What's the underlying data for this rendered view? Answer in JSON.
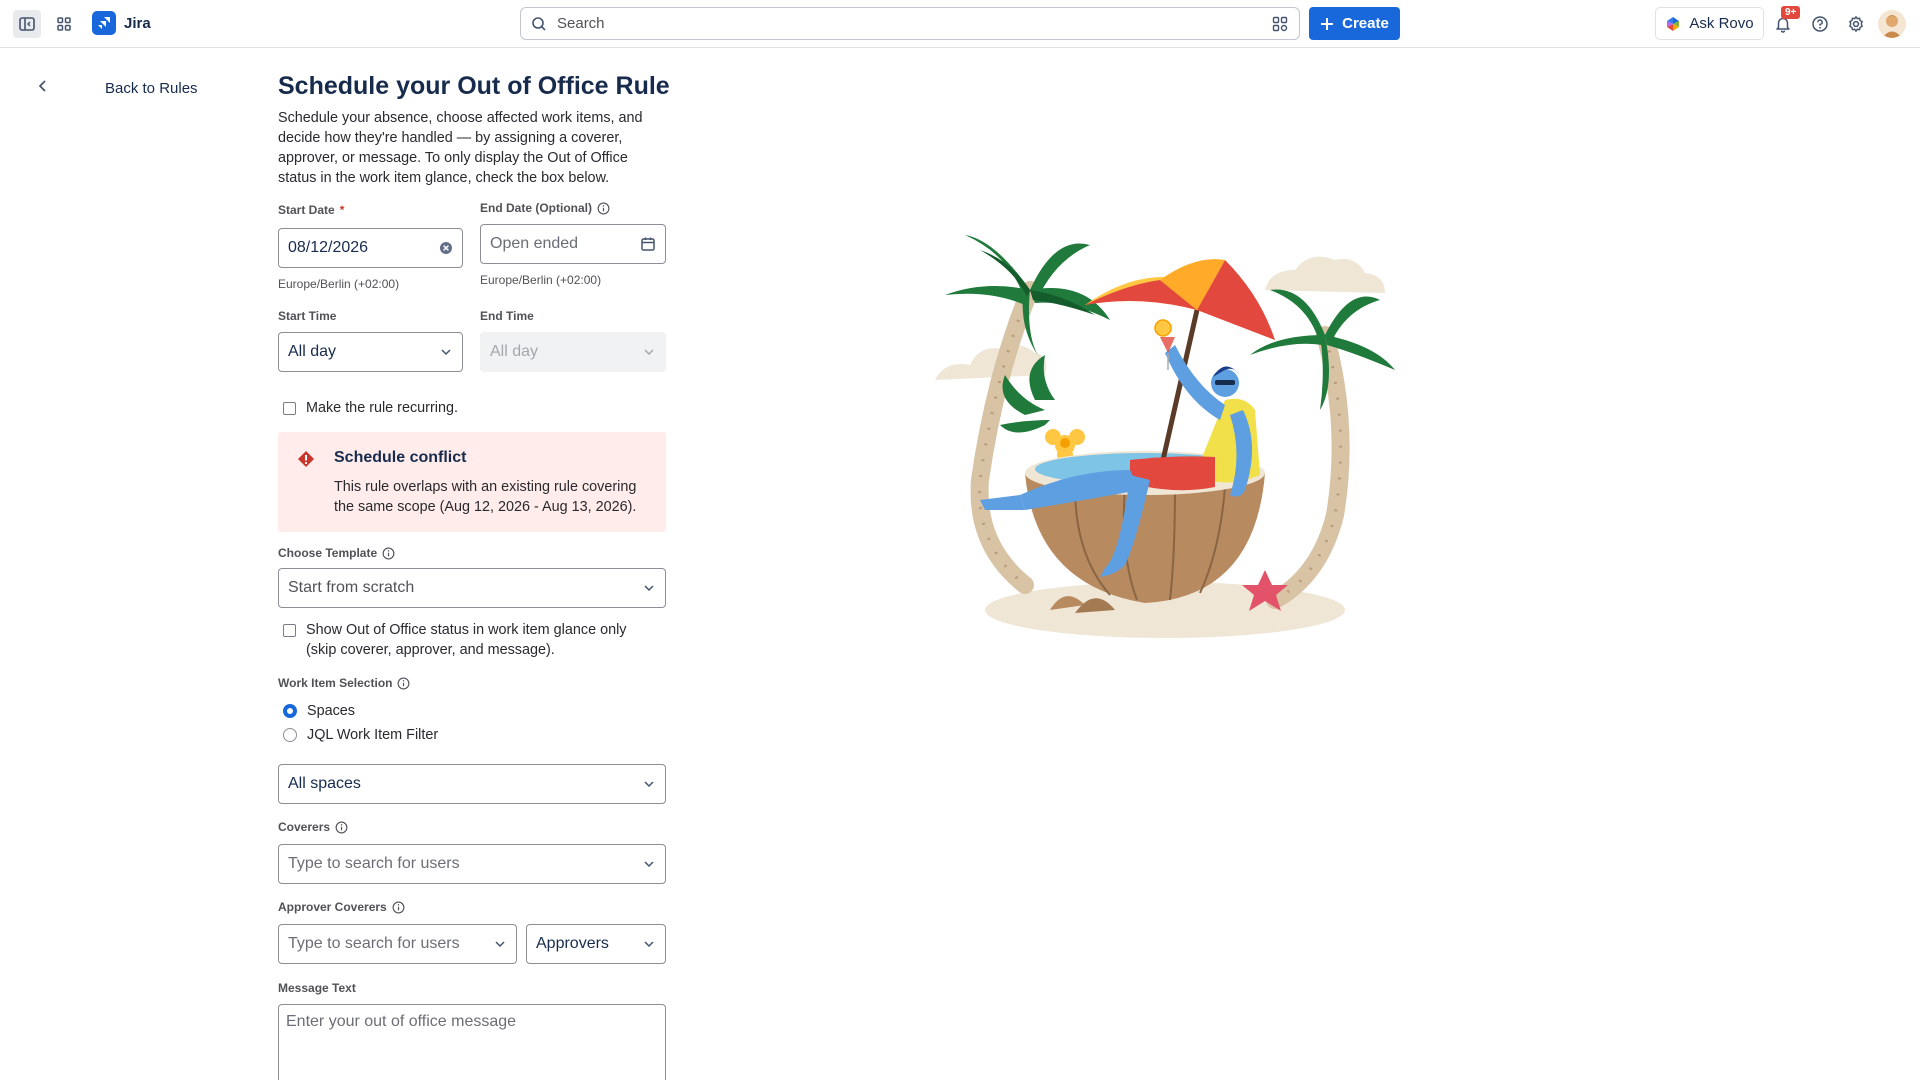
{
  "topbar": {
    "app_name": "Jira",
    "search_placeholder": "Search",
    "create_label": "Create",
    "ask_rovo_label": "Ask Rovo",
    "notification_count": "9+"
  },
  "nav": {
    "back_label": "Back to Rules"
  },
  "form": {
    "title": "Schedule your Out of Office Rule",
    "intro": "Schedule your absence, choose affected work items, and decide how they're handled — by assigning a coverer, approver, or message. To only display the Out of Office status in the work item glance, check the box below.",
    "start_date": {
      "label": "Start Date",
      "required_mark": "*",
      "value": "08/12/2026",
      "timezone": "Europe/Berlin (+02:00)"
    },
    "end_date": {
      "label": "End Date (Optional)",
      "placeholder": "Open ended",
      "timezone": "Europe/Berlin (+02:00)"
    },
    "start_time": {
      "label": "Start Time",
      "value": "All day"
    },
    "end_time": {
      "label": "End Time",
      "value": "All day"
    },
    "recurring_label": "Make the rule recurring.",
    "conflict": {
      "title": "Schedule conflict",
      "body": "This rule overlaps with an existing rule covering the same scope (Aug 12, 2026 - Aug 13, 2026)."
    },
    "template": {
      "label": "Choose Template",
      "value": "Start from scratch"
    },
    "glance_only_label": "Show Out of Office status in work item glance only (skip coverer, approver, and message).",
    "work_item_selection": {
      "label": "Work Item Selection",
      "options": [
        "Spaces",
        "JQL Work Item Filter"
      ],
      "selected": "Spaces",
      "spaces_value": "All spaces"
    },
    "coverers": {
      "label": "Coverers",
      "placeholder": "Type to search for users"
    },
    "approver_coverers": {
      "label": "Approver Coverers",
      "placeholder": "Type to search for users",
      "role_value": "Approvers"
    },
    "message": {
      "label": "Message Text",
      "placeholder": "Enter your out of office message"
    }
  },
  "colors": {
    "brand_blue": "#1868db",
    "danger": "#c9372c",
    "alert_bg": "#ffeceb"
  }
}
